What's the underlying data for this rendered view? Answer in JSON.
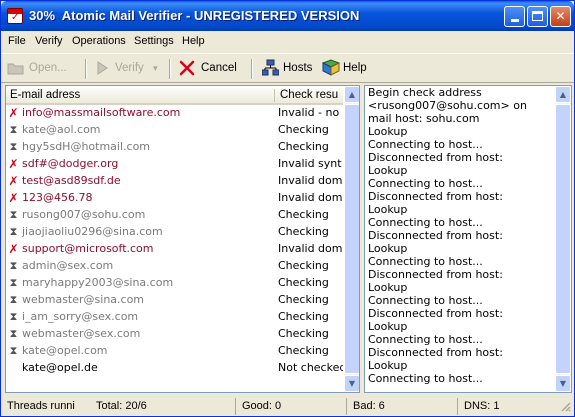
{
  "window": {
    "title": "30%  Atomic Mail Verifier - UNREGISTERED VERSION"
  },
  "menu": [
    "File",
    "Verify",
    "Operations",
    "Settings",
    "Help"
  ],
  "toolbar": {
    "open_label": "Open...",
    "verify_label": "Verify",
    "cancel_label": "Cancel",
    "hosts_label": "Hosts",
    "help_label": "Help"
  },
  "list": {
    "col_email": "E-mail adress",
    "col_status": "Check resu",
    "rows": [
      {
        "email": "info@massmailsoftware.com",
        "status": "Invalid - no",
        "state": "invalid"
      },
      {
        "email": "kate@aol.com",
        "status": "Checking",
        "state": "checking"
      },
      {
        "email": "hgy5sdH@hotmail.com",
        "status": "Checking",
        "state": "checking"
      },
      {
        "email": "sdf#@dodger.org",
        "status": "Invalid synt",
        "state": "invalid"
      },
      {
        "email": "test@asd89sdf.de",
        "status": "Invalid dom",
        "state": "invalid"
      },
      {
        "email": "123@456.78",
        "status": "Invalid dom",
        "state": "invalid"
      },
      {
        "email": "rusong007@sohu.com",
        "status": "Checking",
        "state": "checking"
      },
      {
        "email": "jiaojiaoliu0296@sina.com",
        "status": "Checking",
        "state": "checking"
      },
      {
        "email": "support@microsoft.com",
        "status": "Invalid dom",
        "state": "invalid"
      },
      {
        "email": "admin@sex.com",
        "status": "Checking",
        "state": "checking"
      },
      {
        "email": "maryhappy2003@sina.com",
        "status": "Checking",
        "state": "checking"
      },
      {
        "email": "webmaster@sina.com",
        "status": "Checking",
        "state": "checking"
      },
      {
        "email": "i_am_sorry@sex.com",
        "status": "Checking",
        "state": "checking"
      },
      {
        "email": "webmaster@sex.com",
        "status": "Checking",
        "state": "checking"
      },
      {
        "email": "kate@opel.com",
        "status": "Checking",
        "state": "checking"
      },
      {
        "email": "kate@opel.de",
        "status": "Not checked",
        "state": "pending"
      }
    ]
  },
  "log": {
    "text": "Begin check address\n<rusong007@sohu.com> on\nmail host: sohu.com\nLookup\nConnecting to host...\nDisconnected from host:\nLookup\nConnecting to host...\nDisconnected from host:\nLookup\nConnecting to host...\nDisconnected from host:\nLookup\nConnecting to host...\nDisconnected from host:\nLookup\nConnecting to host...\nDisconnected from host:\nLookup\nConnecting to host...\nDisconnected from host:\nLookup\nConnecting to host..."
  },
  "status": {
    "threads": "Threads runnin",
    "total": "Total: 20/6",
    "good": "Good: 0",
    "bad": "Bad: 6",
    "dns": "DNS: 1"
  }
}
